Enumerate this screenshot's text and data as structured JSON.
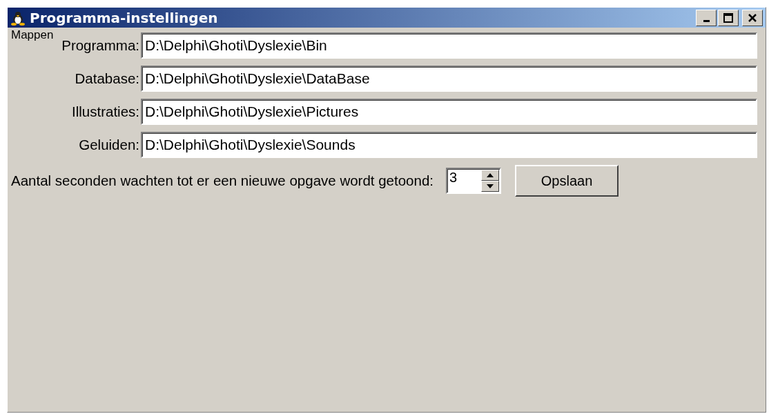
{
  "window": {
    "title": "Programma-instellingen"
  },
  "group": {
    "title": "Mappen"
  },
  "folders": [
    {
      "label": "Programma:",
      "value": "D:\\Delphi\\Ghoti\\Dyslexie\\Bin"
    },
    {
      "label": "Database:",
      "value": "D:\\Delphi\\Ghoti\\Dyslexie\\DataBase"
    },
    {
      "label": "Illustraties:",
      "value": "D:\\Delphi\\Ghoti\\Dyslexie\\Pictures"
    },
    {
      "label": "Geluiden:",
      "value": "D:\\Delphi\\Ghoti\\Dyslexie\\Sounds"
    }
  ],
  "delay": {
    "label": "Aantal seconden wachten tot er een nieuwe opgave wordt getoond:",
    "value": "3"
  },
  "buttons": [
    {
      "label": "Opslaan"
    }
  ]
}
